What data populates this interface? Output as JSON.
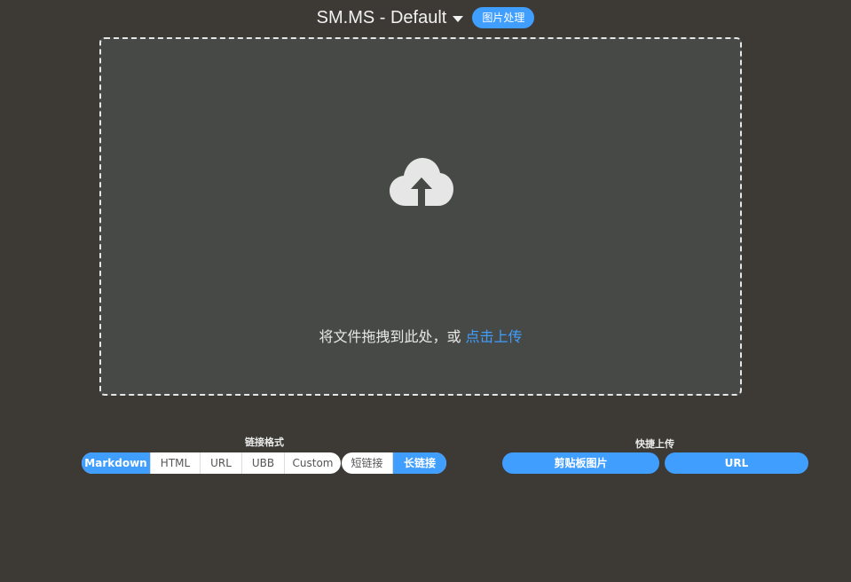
{
  "header": {
    "title": "SM.MS - Default",
    "badge": "图片处理"
  },
  "dropzone": {
    "text": "将文件拖拽到此处，或 ",
    "link": "点击上传",
    "icon": "cloud-upload-icon"
  },
  "link_format": {
    "label": "链接格式",
    "options": [
      "Markdown",
      "HTML",
      "URL",
      "UBB",
      "Custom"
    ],
    "selected": "Markdown",
    "length_options": [
      "短链接",
      "长链接"
    ],
    "length_selected": "长链接"
  },
  "quick_upload": {
    "label": "快捷上传",
    "clipboard": "剪贴板图片",
    "url": "URL"
  },
  "colors": {
    "background": "#3d3a36",
    "dropzone": "#474946",
    "accent": "#409eff"
  }
}
